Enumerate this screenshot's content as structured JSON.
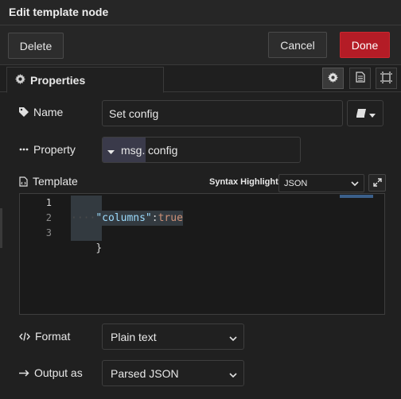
{
  "window": {
    "title": "Edit template node"
  },
  "buttons": {
    "delete": "Delete",
    "cancel": "Cancel",
    "done": "Done"
  },
  "tabs": {
    "properties": "Properties"
  },
  "form": {
    "name": {
      "label": "Name",
      "value": "Set config"
    },
    "property": {
      "label": "Property",
      "type": "msg.",
      "value": "config"
    },
    "template": {
      "label": "Template",
      "syntax_label": "Syntax Highlight:",
      "syntax_value": "JSON",
      "line_numbers": [
        "1",
        "2",
        "3"
      ],
      "lines": {
        "l1": "{",
        "l2_ws": "····",
        "l2_key": "\"columns\"",
        "l2_colon": ":",
        "l2_val": "true",
        "l3": "}"
      }
    },
    "format": {
      "label": "Format",
      "value": "Plain text"
    },
    "output": {
      "label": "Output as",
      "value": "Parsed JSON"
    }
  },
  "colors": {
    "done_button": "#b41c26",
    "background": "#202020"
  }
}
